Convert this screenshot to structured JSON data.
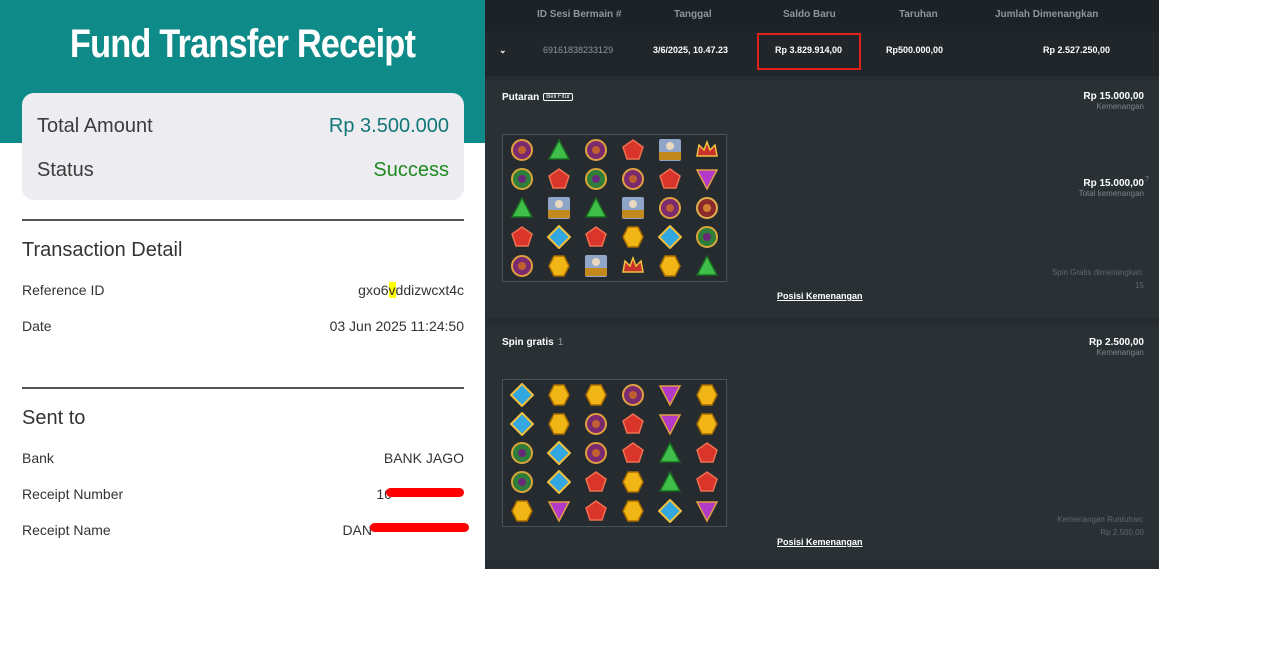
{
  "receipt": {
    "title": "Fund Transfer Receipt",
    "total_amount_label": "Total Amount",
    "total_amount_value": "Rp 3.500.000",
    "status_label": "Status",
    "status_value": "Success",
    "transaction_detail_title": "Transaction Detail",
    "reference_id_label": "Reference ID",
    "reference_id_pre": "gxo6",
    "reference_id_hl": "v",
    "reference_id_post": "ddizwcxt4c",
    "date_label": "Date",
    "date_value": "03 Jun 2025 11:24:50",
    "sent_to_title": "Sent to",
    "bank_label": "Bank",
    "bank_value": "BANK JAGO",
    "receipt_number_label": "Receipt Number",
    "receipt_number_value": "10",
    "receipt_name_label": "Receipt Name",
    "receipt_name_value": "DAN"
  },
  "game": {
    "headers": [
      "ID Sesi Bermain #",
      "Tanggal",
      "Saldo Baru",
      "Taruhan",
      "Jumlah Dimenangkan"
    ],
    "row": {
      "session_id": "69161838233129",
      "date": "3/6/2025, 10.47.23",
      "balance": "Rp 3.829.914,00",
      "bet": "Rp500.000,00",
      "win": "Rp 2.527.250,00"
    },
    "spin": {
      "label": "Putaran",
      "badge": "Beli Fitur",
      "win_value": "Rp 15.000,00",
      "win_label": "Kemenangan",
      "total_value": "Rp 15.000,00",
      "total_label": "Total kemenangan",
      "free_spins_label": "Spin Gratis dimenangkan:",
      "free_spins_value": "15",
      "link": "Posisi Kemenangan",
      "grid": [
        [
          "purple-ring",
          "green-tri",
          "purple-ring",
          "red-pent",
          "scatter",
          "red-crown"
        ],
        [
          "green-ring",
          "red-pent",
          "green-ring",
          "purple-ring",
          "red-pent",
          "purple-tri"
        ],
        [
          "green-tri",
          "scatter",
          "green-tri",
          "scatter",
          "purple-ring",
          "red-ring"
        ],
        [
          "red-pent",
          "blue-dia",
          "red-pent",
          "gold-hex",
          "blue-dia",
          "green-ring"
        ],
        [
          "purple-ring",
          "gold-hex",
          "scatter",
          "red-crown",
          "gold-hex",
          "green-tri"
        ]
      ]
    },
    "free_spin": {
      "label": "Spin gratis",
      "count": "1",
      "win_value": "Rp 2.500,00",
      "win_label": "Kemenangan",
      "tumble_label": "Kemenangan Runtuhan:",
      "tumble_value": "Rp 2.500,00",
      "link": "Posisi Kemenangan",
      "grid": [
        [
          "blue-dia",
          "gold-hex",
          "gold-hex",
          "purple-ring",
          "purple-tri",
          "gold-hex"
        ],
        [
          "blue-dia",
          "gold-hex",
          "purple-ring",
          "red-pent",
          "purple-tri",
          "gold-hex"
        ],
        [
          "green-ring",
          "blue-dia",
          "purple-ring",
          "red-pent",
          "green-tri",
          "red-pent"
        ],
        [
          "green-ring",
          "blue-dia",
          "red-pent",
          "gold-hex",
          "green-tri",
          "red-pent"
        ],
        [
          "gold-hex",
          "purple-tri",
          "red-pent",
          "gold-hex",
          "blue-dia",
          "purple-tri"
        ]
      ]
    }
  }
}
